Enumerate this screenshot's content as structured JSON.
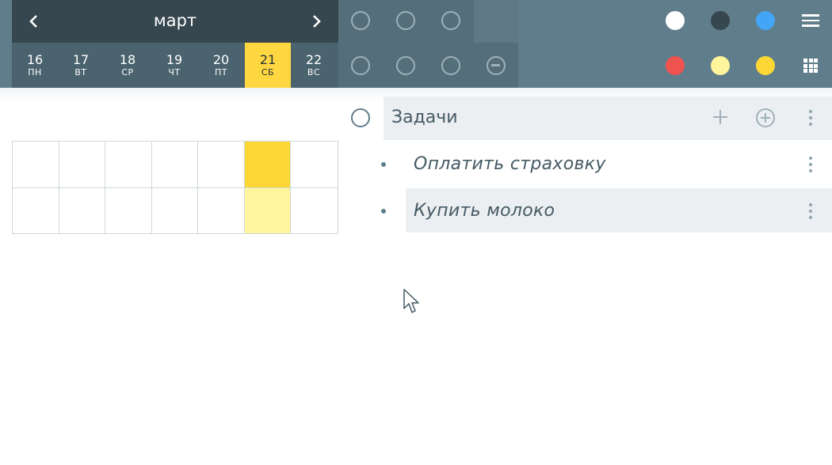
{
  "calendar": {
    "month": "март",
    "days": [
      {
        "num": "16",
        "dow": "ПН",
        "selected": false
      },
      {
        "num": "17",
        "dow": "ВТ",
        "selected": false
      },
      {
        "num": "18",
        "dow": "СР",
        "selected": false
      },
      {
        "num": "19",
        "dow": "ЧТ",
        "selected": false
      },
      {
        "num": "20",
        "dow": "ПТ",
        "selected": false
      },
      {
        "num": "21",
        "dow": "СБ",
        "selected": true
      },
      {
        "num": "22",
        "dow": "ВС",
        "selected": false
      }
    ]
  },
  "colors": {
    "toolbar_bg": "#607d8b",
    "selected_day": "#ffd740",
    "highlight_cell_1": "#fdd835",
    "highlight_cell_2": "#fff59d",
    "palette_top": [
      "#ffffff",
      "#37474f",
      "#42a5f5"
    ],
    "palette_bottom": [
      "#ef5350",
      "#fff59d",
      "#fdd835"
    ]
  },
  "tasks": {
    "header": "Задачи",
    "items": [
      {
        "text": "Оплатить страховку",
        "highlighted": false
      },
      {
        "text": "Купить молоко",
        "highlighted": true
      }
    ]
  }
}
